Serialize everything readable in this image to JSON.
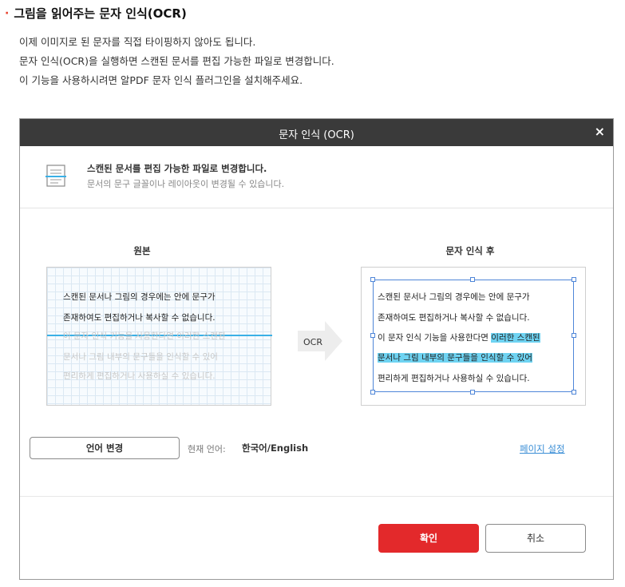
{
  "page": {
    "bullet": "·",
    "heading": "그림을 읽어주는 문자 인식(OCR)",
    "description": [
      "이제 이미지로 된 문자를 직접 타이핑하지 않아도 됩니다.",
      "문자 인식(OCR)을 실행하면 스캔된 문서를 편집 가능한 파일로 변경합니다.",
      "이 기능을 사용하시려면 알PDF 문자 인식 플러그인을 설치해주세요."
    ]
  },
  "dialog": {
    "title": "문자 인식 (OCR)",
    "close_label": "×",
    "info_main": "스캔된 문서를 편집 가능한 파일로 변경합니다.",
    "info_sub": "문서의 문구 글꼴이나 레이아웃이 변경될 수 있습니다.",
    "original_label": "원본",
    "result_label": "문자 인식 후",
    "arrow_label": "OCR",
    "original_lines": [
      "스캔된 문서나 그림의 경우에는 안에 문구가",
      "존재하여도 편집하거나 복사할 수 없습니다.",
      "이 문자 인식 기능을 사용한다면 이러한 스캔된",
      "문서나 그림 내부의 문구들을 인식할 수 있어",
      "편리하게 편집하거나 사용하실 수 있습니다."
    ],
    "result_lines": {
      "line1": "스캔된 문서나 그림의 경우에는 안에 문구가",
      "line2": "존재하여도 편집하거나 복사할 수 없습니다.",
      "line3_plain": "이 문자 인식 기능을 사용한다면 ",
      "line3_highlight": "이러한 스캔된",
      "line4_highlight": "문서나 그림 내부의 문구들을 인식할 수 있어",
      "line5": "편리하게 편집하거나 사용하실 수 있습니다."
    },
    "language_button": "언어 변경",
    "current_language_label": "현재 언어:",
    "current_language_value": "한국어/English",
    "page_settings_link": "페이지 설정",
    "ok_button": "확인",
    "cancel_button": "취소",
    "colors": {
      "titlebar": "#3a3a3a",
      "ok_button": "#e3292b",
      "highlight": "#6ed3f2",
      "scanline": "#3ab0e6",
      "link": "#3a8ed6"
    }
  }
}
